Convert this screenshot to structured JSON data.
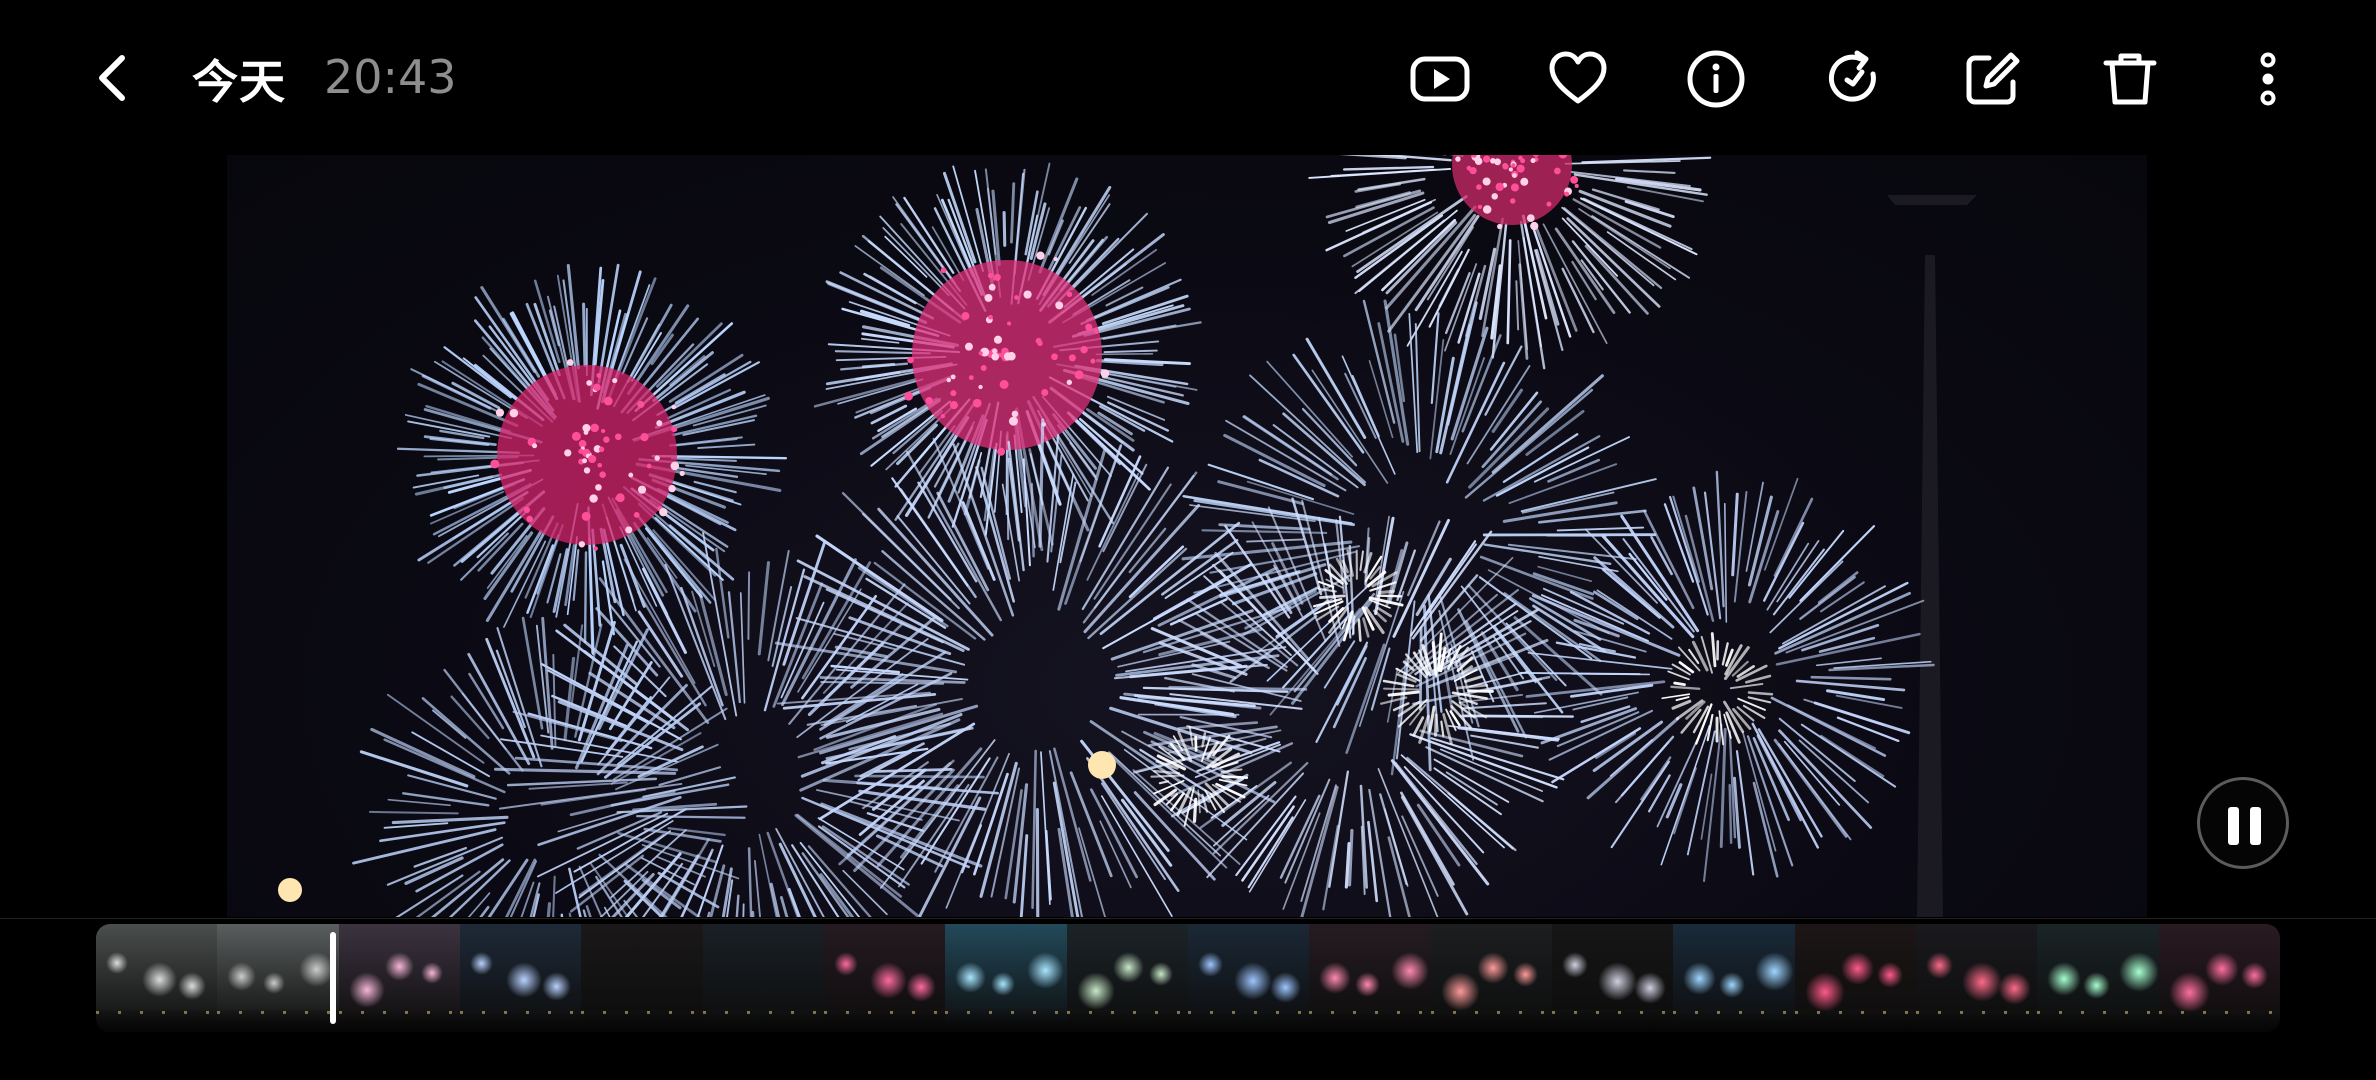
{
  "header": {
    "title": "今天",
    "time": "20:43",
    "icons": [
      "back-icon",
      "slideshow-icon",
      "favorite-icon",
      "info-icon",
      "rotate-icon",
      "edit-icon",
      "delete-icon",
      "more-icon"
    ]
  },
  "viewer": {
    "content": "fireworks-photo",
    "playback_state": "playing",
    "control_icon": "pause-icon"
  },
  "filmstrip": {
    "frame_count": 18,
    "playhead_position": 0.108
  },
  "colors": {
    "background": "#000000",
    "time_text": "#8e8e8e",
    "accent": "#ffffff"
  }
}
